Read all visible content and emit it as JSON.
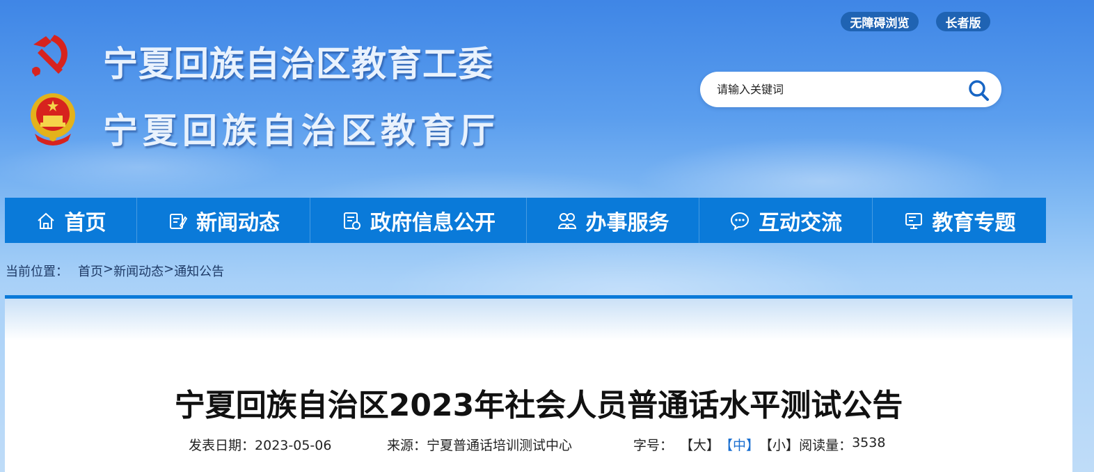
{
  "header": {
    "title_line1": "宁夏回族自治区教育工委",
    "title_line2": "宁夏回族自治区教育厅",
    "accessible_label": "无障碍浏览",
    "elder_label": "长者版"
  },
  "search": {
    "placeholder": "请输入关键词"
  },
  "nav": {
    "items": [
      {
        "label": "首页",
        "icon": "home-icon"
      },
      {
        "label": "新闻动态",
        "icon": "news-icon"
      },
      {
        "label": "政府信息公开",
        "icon": "document-icon"
      },
      {
        "label": "办事服务",
        "icon": "service-icon"
      },
      {
        "label": "互动交流",
        "icon": "chat-icon"
      },
      {
        "label": "教育专题",
        "icon": "monitor-icon"
      }
    ]
  },
  "breadcrumb": {
    "label": "当前位置：",
    "items": [
      "首页",
      "新闻动态",
      "通知公告"
    ],
    "separator": ">"
  },
  "article": {
    "title": "宁夏回族自治区2023年社会人员普通话水平测试公告",
    "date_label": "发表日期：",
    "date": "2023-05-06",
    "source_label": "来源：",
    "source": "宁夏普通话培训测试中心",
    "font_size_label": "字号：",
    "font_large": "【大】",
    "font_medium": "【中】",
    "font_small": "【小】",
    "views_label": "阅读量：",
    "views": "3538"
  },
  "colors": {
    "nav_bg": "#0a7ad9",
    "pill_bg": "#1f63b3",
    "active_font_size": "#1a6fd0"
  }
}
